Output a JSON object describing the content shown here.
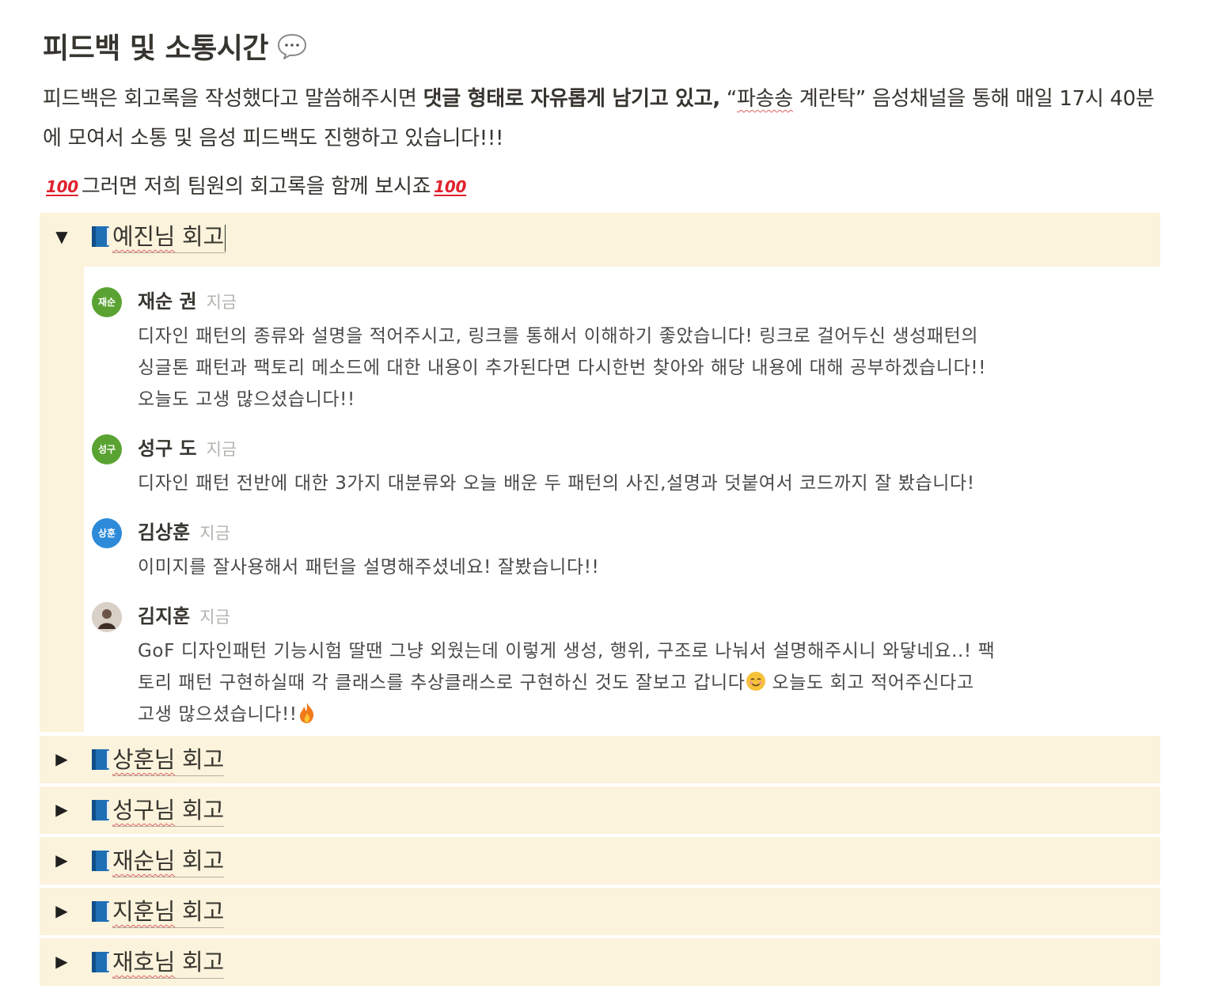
{
  "heading": "피드백 및 소통시간",
  "paragraph": {
    "part1": "피드백은 회고록을 작성했다고 말씀해주시면 ",
    "bold": "댓글 형태로 자유롭게 남기고 있고,",
    "part2": "  “",
    "channel_name": "파송송",
    "part3": " 계란탁” 음성채널을 통해 매일 17시 40분에 모여서 소통 및 음성 피드백도 진행하고 있습니다!!!"
  },
  "intro": {
    "emoji": "100",
    "text": "그러면 저희 팀원의 회고록을 함께 보시죠"
  },
  "toggles": [
    {
      "name": "예진님",
      "suffix": " 회고",
      "expanded": true,
      "arrow": "▼"
    },
    {
      "name": "상훈님",
      "suffix": " 회고",
      "expanded": false,
      "arrow": "▶"
    },
    {
      "name": "성구님",
      "suffix": " 회고",
      "expanded": false,
      "arrow": "▶"
    },
    {
      "name": "재순님",
      "suffix": " 회고",
      "expanded": false,
      "arrow": "▶"
    },
    {
      "name": "지훈님",
      "suffix": " 회고",
      "expanded": false,
      "arrow": "▶"
    },
    {
      "name": "재호님",
      "suffix": " 회고",
      "expanded": false,
      "arrow": "▶"
    }
  ],
  "comments": [
    {
      "avatar_text": "재순",
      "avatar_color": "#5aa332",
      "author": "재순 권",
      "time": "지금",
      "lines": [
        "디자인 패턴의 종류와 설명을 적어주시고, 링크를 통해서 이해하기 좋았습니다! 링크로 걸어두신 생성패턴의",
        "싱글톤 패턴과 팩토리 메소드에 대한 내용이 추가된다면 다시한번 찾아와 해당 내용에 대해 공부하겠습니다!!",
        "오늘도 고생 많으셨습니다!!"
      ]
    },
    {
      "avatar_text": "성구",
      "avatar_color": "#5aa332",
      "author": "성구 도",
      "time": "지금",
      "lines": [
        "디자인 패턴 전반에 대한 3가지 대분류와 오늘 배운 두 패턴의 사진,설명과 덧붙여서 코드까지 잘 봤습니다!"
      ]
    },
    {
      "avatar_text": "상훈",
      "avatar_color": "#2d8ad8",
      "author": "김상훈",
      "time": "지금",
      "lines": [
        "이미지를 잘사용해서 패턴을 설명해주셨네요! 잘봤습니다!!"
      ]
    },
    {
      "avatar_text": "",
      "avatar_color": "#cfc6bf",
      "author": "김지훈",
      "time": "지금",
      "lines": [
        "GoF 디자인패턴 기능시험 딸땐 그냥 외웠는데 이렇게 생성, 행위, 구조로 나눠서 설명해주시니 와닿네요..! 팩",
        "토리 패턴 구현하실때 각 클래스를 추상클래스로 구현하신 것도 잘보고 갑니다",
        "  오늘도 회고 적어주신다고",
        "고생 많으셨습니다!!"
      ]
    }
  ],
  "colors": {
    "toggle_bg": "#fbf3db",
    "text": "#37352f",
    "muted": "#b5b3ae"
  }
}
